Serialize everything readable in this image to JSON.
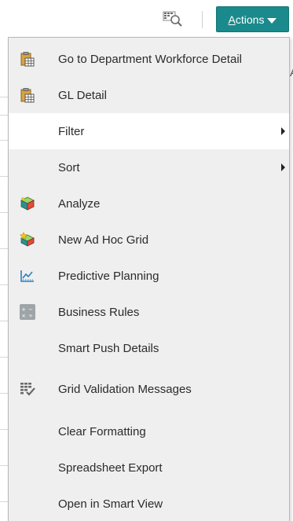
{
  "toolbar": {
    "grid_icon": "grid-search-icon",
    "actions_label_mnemonic": "A",
    "actions_label_rest": "ctions",
    "actions_color": "#1a8a8c"
  },
  "menu": {
    "items": [
      {
        "label": "Go to Department Workforce Detail",
        "icon": "clipboard-grid-icon"
      },
      {
        "label": "GL Detail",
        "icon": "clipboard-grid-icon"
      },
      {
        "label": "Filter",
        "submenu": true
      },
      {
        "label": "Sort",
        "submenu": true
      },
      {
        "label": "Analyze",
        "icon": "analyze-cube-icon"
      },
      {
        "label": "New Ad Hoc Grid",
        "icon": "new-ad-hoc-grid-icon"
      },
      {
        "label": "Predictive Planning",
        "icon": "predictive-chart-icon"
      },
      {
        "label": "Business Rules",
        "icon": "calculator-icon"
      },
      {
        "label": "Smart Push Details"
      },
      {
        "label": "Grid Validation Messages",
        "icon": "grid-validation-icon"
      },
      {
        "label": "Clear Formatting"
      },
      {
        "label": "Spreadsheet Export"
      },
      {
        "label": "Open in Smart View"
      }
    ]
  },
  "background": {
    "clipped_column_letter": "A"
  }
}
